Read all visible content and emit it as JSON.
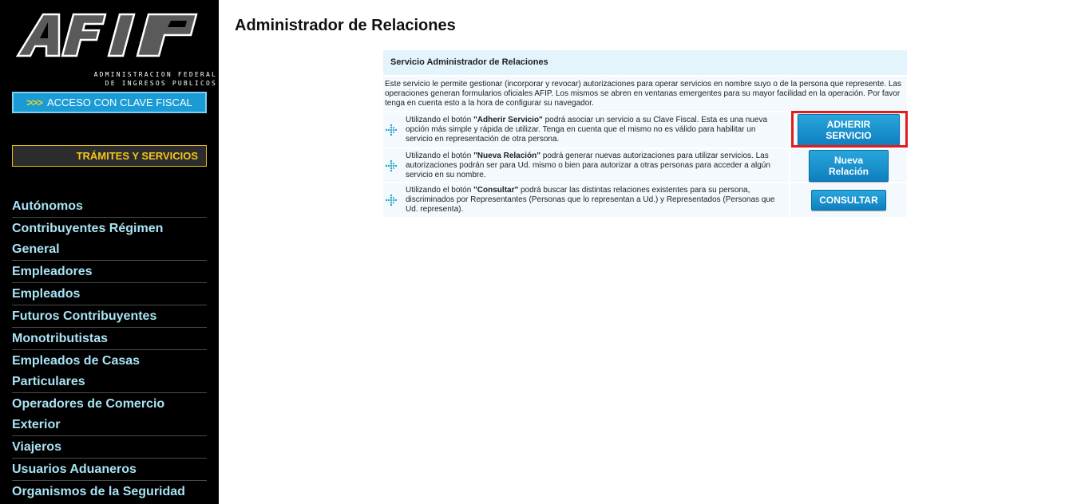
{
  "sidebar": {
    "logo_text": "AFIP",
    "logo_subtitle_line1": "ADMINISTRACION FEDERAL",
    "logo_subtitle_line2": "DE INGRESOS PUBLICOS",
    "clave_fiscal_arrows": ">>>",
    "clave_fiscal_label": "ACCESO CON CLAVE FISCAL",
    "tramites_label": "TRÁMITES Y SERVICIOS",
    "nav_items": [
      "Autónomos",
      "Contribuyentes Régimen General",
      "Empleadores",
      "Empleados",
      "Futuros Contribuyentes",
      "Monotributistas",
      "Empleados de Casas Particulares",
      "Operadores de Comercio Exterior",
      "Viajeros",
      "Usuarios Aduaneros",
      "Organismos de la Seguridad Social"
    ]
  },
  "main": {
    "title": "Administrador de Relaciones",
    "panel": {
      "header": "Servicio Administrador de Relaciones",
      "intro": "Este servicio le permite gestionar (incorporar y revocar) autorizaciones para operar servicios en nombre suyo o de la persona que represente. Las operaciones generan formularios oficiales AFIP. Los mismos se abren en ventanas emergentes para su mayor facilidad en la operación. Por favor tenga en cuenta esto a la hora de configurar su navegador.",
      "rows": [
        {
          "text_pre": "Utilizando el botón ",
          "text_bold": "\"Adherir Servicio\"",
          "text_post": " podrá asociar un servicio a su Clave Fiscal. Esta es una nueva opción más simple y rápida de utilizar. Tenga en cuenta que el mismo no es válido para habilitar un servicio en representación de otra persona.",
          "button": "ADHERIR SERVICIO"
        },
        {
          "text_pre": "Utilizando el botón ",
          "text_bold": "\"Nueva Relación\"",
          "text_post": " podrá generar nuevas autorizaciones para utilizar servicios. Las autorizaciones podrán ser para Ud. mismo o bien para autorizar a otras personas para acceder a algún servicio en su nombre.",
          "button": "Nueva Relación"
        },
        {
          "text_pre": "Utilizando el botón ",
          "text_bold": "\"Consultar\"",
          "text_post": " podrá buscar las distintas relaciones existentes para su persona, discriminados por Representantes (Personas que lo representan a Ud.) y Representados (Personas que Ud. representa).",
          "button": "CONSULTAR"
        }
      ]
    }
  },
  "colors": {
    "sidebar_bg": "#000000",
    "nav_text": "#a9e3f5",
    "clave_btn": "#1a9bd6",
    "tramites_text": "#f4c61b",
    "panel_header_bg": "#e3f4fc",
    "panel_row_bg": "#f3f9fd",
    "button_blue": "#1a8fcc",
    "highlight_red": "#e21b1b"
  }
}
